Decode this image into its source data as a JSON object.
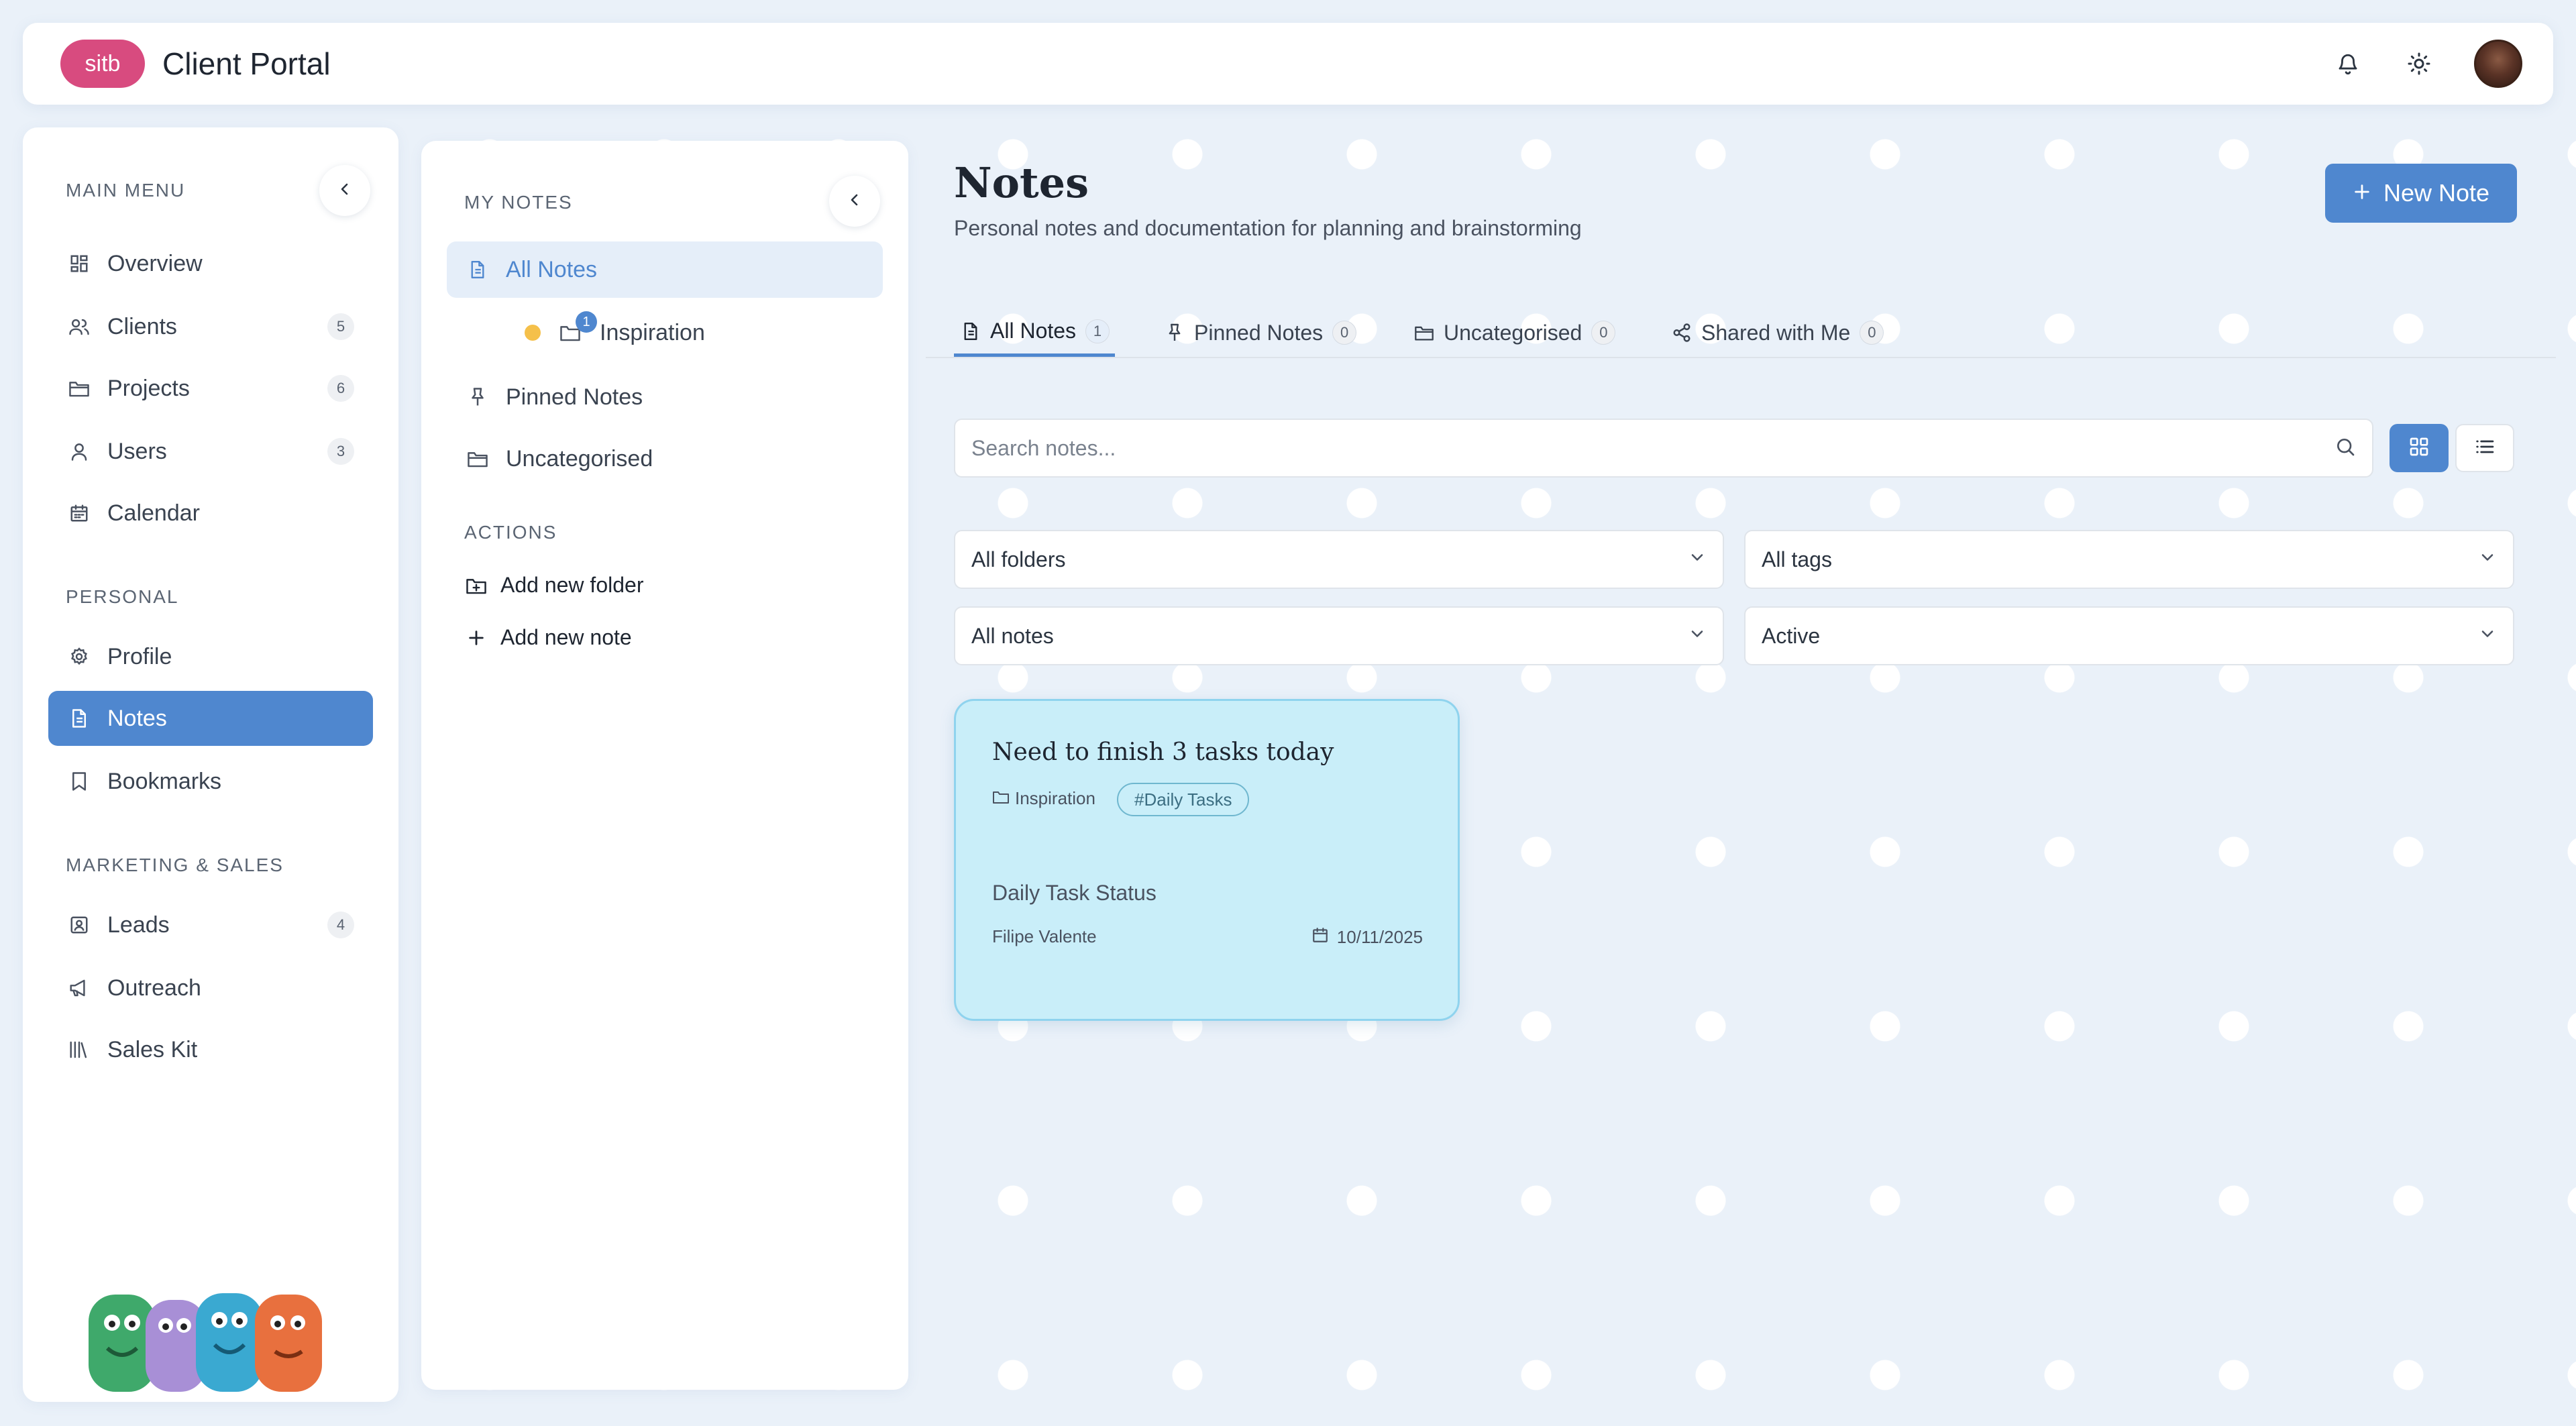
{
  "header": {
    "brand_badge": "sitb",
    "app_title": "Client Portal",
    "icons": [
      "bell-icon",
      "sun-icon",
      "avatar"
    ]
  },
  "sidebar": {
    "main_menu_label": "MAIN MENU",
    "main_items": [
      {
        "label": "Overview",
        "icon": "dashboard-icon"
      },
      {
        "label": "Clients",
        "icon": "users-icon",
        "count": "5"
      },
      {
        "label": "Projects",
        "icon": "folder-icon",
        "count": "6"
      },
      {
        "label": "Users",
        "icon": "user-icon",
        "count": "3"
      },
      {
        "label": "Calendar",
        "icon": "calendar-icon"
      }
    ],
    "personal_label": "PERSONAL",
    "personal_items": [
      {
        "label": "Profile",
        "icon": "gear-icon"
      },
      {
        "label": "Notes",
        "icon": "document-icon",
        "active": true
      },
      {
        "label": "Bookmarks",
        "icon": "bookmark-icon"
      }
    ],
    "marketing_label": "MARKETING & SALES",
    "marketing_items": [
      {
        "label": "Leads",
        "icon": "contact-icon",
        "count": "4"
      },
      {
        "label": "Outreach",
        "icon": "megaphone-icon"
      },
      {
        "label": "Sales Kit",
        "icon": "library-icon"
      }
    ]
  },
  "notes_panel": {
    "section_label": "MY NOTES",
    "items": [
      {
        "label": "All Notes",
        "active": true
      },
      {
        "label": "Inspiration",
        "badge": "1",
        "dot_color": "#f5c04a"
      },
      {
        "label": "Pinned Notes"
      },
      {
        "label": "Uncategorised"
      }
    ],
    "actions_label": "ACTIONS",
    "actions": [
      {
        "label": "Add new folder"
      },
      {
        "label": "Add new note"
      }
    ]
  },
  "main": {
    "title": "Notes",
    "subtitle": "Personal notes and documentation for planning and brainstorming",
    "new_note_label": "New Note",
    "tabs": [
      {
        "label": "All Notes",
        "count": "1",
        "active": true
      },
      {
        "label": "Pinned Notes",
        "count": "0"
      },
      {
        "label": "Uncategorised",
        "count": "0"
      },
      {
        "label": "Shared with Me",
        "count": "0"
      }
    ],
    "search": {
      "placeholder": "Search notes...",
      "value": ""
    },
    "filters": {
      "folder": "All folders",
      "tags": "All tags",
      "notes": "All notes",
      "status": "Active"
    },
    "view_mode": "grid"
  },
  "cards": [
    {
      "title": "Need to finish 3 tasks today",
      "folder": "Inspiration",
      "tag": "#Daily Tasks",
      "status": "Daily Task Status",
      "author": "Filipe Valente",
      "date": "10/11/2025"
    }
  ],
  "colors": {
    "accent": "#4f87cf",
    "brand": "#d84b7f",
    "card_bg": "#c9eef9",
    "page_bg": "#eaf1f9"
  }
}
